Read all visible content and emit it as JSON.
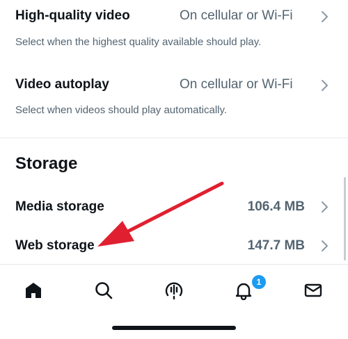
{
  "video": {
    "high_quality": {
      "title": "High-quality video",
      "value": "On cellular or Wi-Fi",
      "description": "Select when the highest quality available should play."
    },
    "autoplay": {
      "title": "Video autoplay",
      "value": "On cellular or Wi-Fi",
      "description": "Select when videos should play automatically."
    }
  },
  "storage": {
    "section_title": "Storage",
    "media": {
      "title": "Media storage",
      "value": "106.4 MB"
    },
    "web": {
      "title": "Web storage",
      "value": "147.7 MB"
    }
  },
  "tabbar": {
    "items": [
      "home-icon",
      "search-icon",
      "spaces-icon",
      "notifications-icon",
      "messages-icon"
    ],
    "notifications_badge": "1"
  },
  "colors": {
    "accent": "#1d9bf0",
    "arrow": "#e02030",
    "secondary_text": "#536471"
  }
}
